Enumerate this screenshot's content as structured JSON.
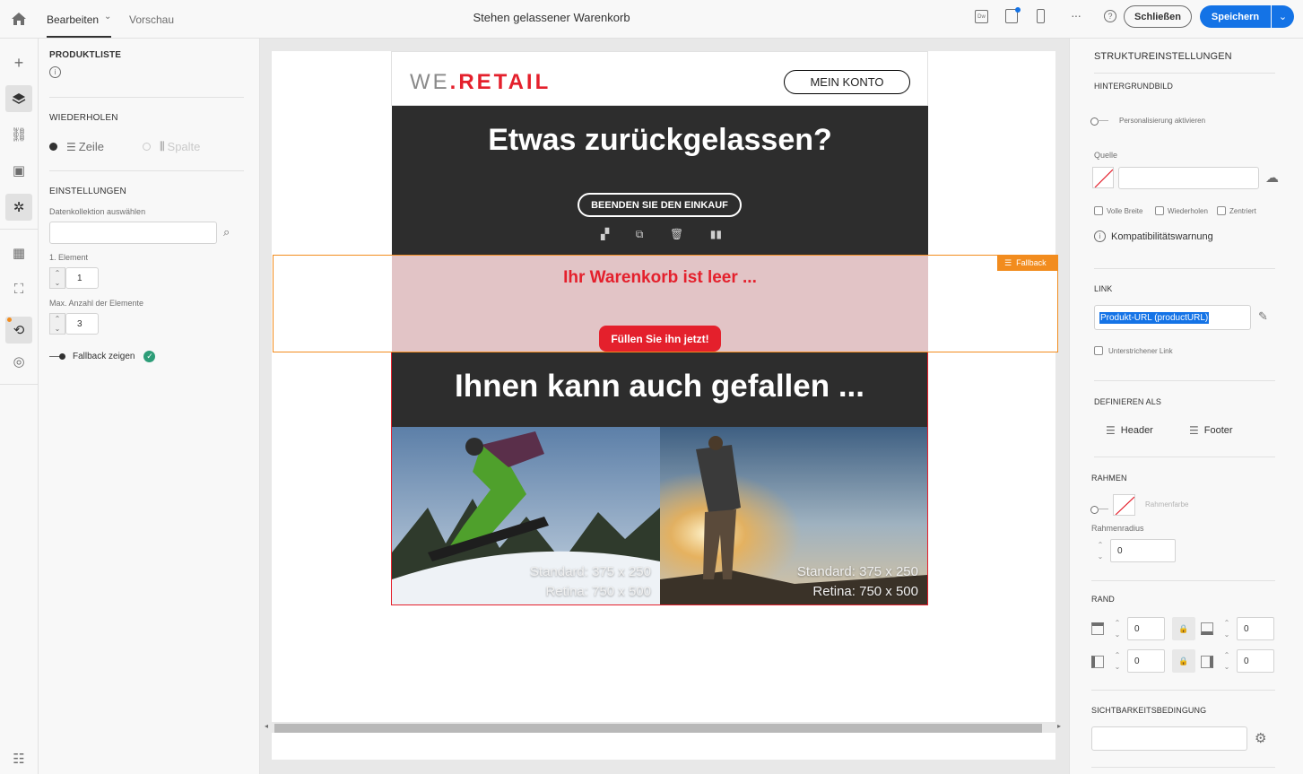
{
  "topbar": {
    "tab_edit": "Bearbeiten",
    "tab_preview": "Vorschau",
    "document_title": "Stehen gelassener Warenkorb",
    "close_label": "Schließen",
    "save_label": "Speichern"
  },
  "left_panel": {
    "title": "PRODUKTLISTE",
    "repeat_title": "WIEDERHOLEN",
    "repeat_row": "Zeile",
    "repeat_column": "Spalte",
    "settings_title": "EINSTELLUNGEN",
    "collection_label": "Datenkollektion auswählen",
    "collection_value": "",
    "first_element_label": "1. Element",
    "first_element_value": "1",
    "max_elements_label": "Max. Anzahl der Elemente",
    "max_elements_value": "3",
    "fallback_label": "Fallback zeigen"
  },
  "email": {
    "logo_we": "WE",
    "logo_dot": ".",
    "logo_retail": "RETAIL",
    "account_button": "MEIN KONTO",
    "headline": "Etwas zurückgelassen?",
    "finish_button": "BEENDEN SIE DEN EINKAUF",
    "fallback_tag": "Fallback",
    "empty_cart_text": "Ihr Warenkorb ist leer ...",
    "fill_button": "Füllen Sie ihn jetzt!",
    "also_like_headline": "Ihnen kann auch gefallen ...",
    "image1_caption_1": "Standard: 375 x 250",
    "image1_caption_2": "Retina: 750 x 500",
    "image2_caption_1": "Standard: 375 x 250",
    "image2_caption_2": "Retina: 750 x 500"
  },
  "right_panel": {
    "title": "STRUKTUREINSTELLUNGEN",
    "bg_image_title": "HINTERGRUNDBILD",
    "personalize_label": "Personalisierung aktivieren",
    "source_label": "Quelle",
    "source_value": "",
    "full_width_label": "Volle Breite",
    "repeat_label": "Wiederholen",
    "centered_label": "Zentriert",
    "compat_warning": "Kompatibilitätswarnung",
    "link_title": "LINK",
    "link_value": "Produkt-URL (productURL)",
    "underline_label": "Unterstrichener Link",
    "define_as_title": "DEFINIEREN ALS",
    "header_label": "Header",
    "footer_label": "Footer",
    "frame_title": "RAHMEN",
    "frame_color_label": "Rahmenfarbe",
    "frame_radius_label": "Rahmenradius",
    "frame_radius_value": "0",
    "margin_title": "RAND",
    "margin_top": "0",
    "margin_bottom": "0",
    "margin_left": "0",
    "margin_right": "0",
    "visibility_title": "SICHTBARKEITSBEDINGUNG",
    "visibility_value": ""
  },
  "colors": {
    "accent_blue": "#1473e6",
    "brand_red": "#e4202c",
    "fallback_orange": "#f28c1e",
    "dark_block": "#2d2d2d",
    "fallback_bg": "#e2c4c6",
    "valid_green": "#2d9d78"
  }
}
